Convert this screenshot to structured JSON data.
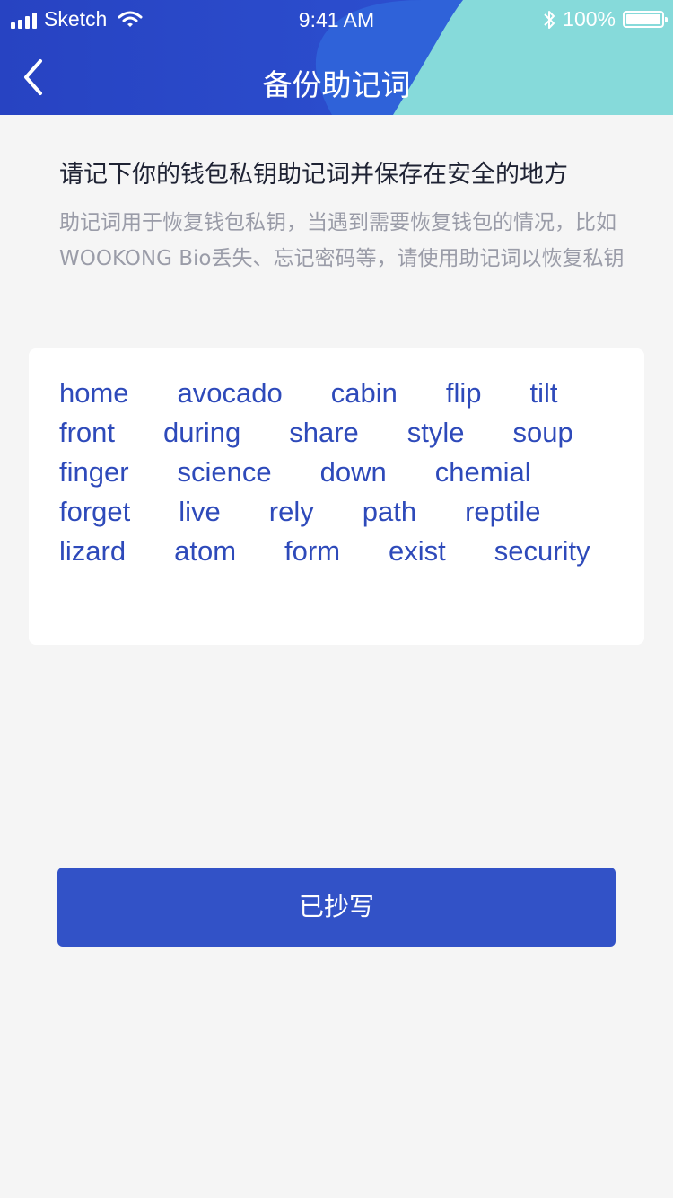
{
  "status_bar": {
    "carrier": "Sketch",
    "time": "9:41 AM",
    "battery": "100%",
    "icons": [
      "signal-icon",
      "wifi-icon",
      "bluetooth-icon",
      "battery-icon"
    ]
  },
  "nav": {
    "back_icon": "chevron-left-icon",
    "title": "备份助记词"
  },
  "intro": {
    "heading": "请记下你的钱包私钥助记词并保存在安全的地方",
    "description": "助记词用于恢复钱包私钥，当遇到需要恢复钱包的情况，比如WOOKONG Bio丢失、忘记密码等，请使用助记词以恢复私钥"
  },
  "mnemonic": {
    "words": [
      "home",
      "avocado",
      "cabin",
      "flip",
      "tilt",
      "front",
      "during",
      "share",
      "style",
      "soup",
      "finger",
      "science",
      "down",
      "chemial",
      "forget",
      "live",
      "rely",
      "path",
      "reptile",
      "lizard",
      "atom",
      "form",
      "exist",
      "security"
    ]
  },
  "actions": {
    "confirm_label": "已抄写"
  },
  "colors": {
    "header_blue": "#2b49c8",
    "header_teal": "#86dada",
    "word_color": "#2e4aba",
    "button_bg": "#3252c7",
    "page_bg": "#f5f5f5"
  }
}
